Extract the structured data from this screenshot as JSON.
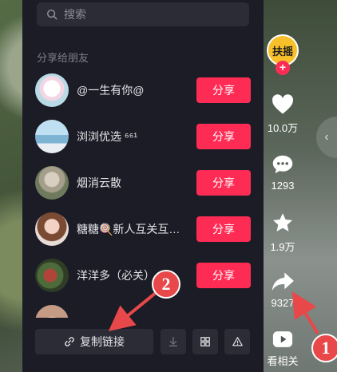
{
  "search": {
    "placeholder": "搜索"
  },
  "section_title": "分享给朋友",
  "friends": [
    {
      "name": "@一生有你@",
      "share_label": "分享"
    },
    {
      "name": "浏浏优选 ⁶⁶¹",
      "share_label": "分享"
    },
    {
      "name": "烟消云散",
      "share_label": "分享"
    },
    {
      "name": "糖糖🍭新人互关互…",
      "share_label": "分享"
    },
    {
      "name": "洋洋多（必关）",
      "share_label": "分享"
    }
  ],
  "bottom_bar": {
    "copy_link_label": "复制链接"
  },
  "rail": {
    "creator_label": "扶摇",
    "plus": "+",
    "likes": "10.0万",
    "comments": "1293",
    "favorites": "1.9万",
    "shares": "9327",
    "related": "看相关"
  },
  "annotations": {
    "badge1": "1",
    "badge2": "2"
  },
  "colors": {
    "accent": "#fe2c55",
    "panel": "#1b1c25",
    "badge": "#e8484a"
  }
}
